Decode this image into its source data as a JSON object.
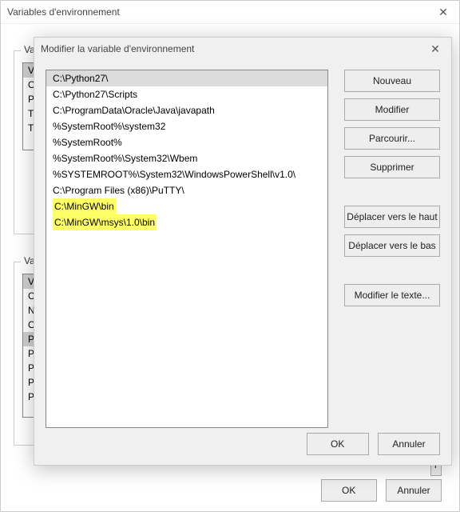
{
  "back_window": {
    "title": "Variables d'environnement",
    "close": "✕",
    "group_user_legend": "Varia",
    "group_system_legend": "Varia",
    "user_vars_col0": [
      "Va",
      "On",
      "Pa",
      "TE",
      "TM"
    ],
    "system_vars_col0": [
      "Va",
      "Co",
      "NU",
      "OS",
      "Pa",
      "PA",
      "PR",
      "PR",
      "PR"
    ],
    "footer": {
      "ok": "OK",
      "cancel": "Annuler"
    },
    "trunc_btn": "r"
  },
  "front_window": {
    "title": "Modifier la variable d'environnement",
    "close": "✕",
    "paths": [
      {
        "text": "C:\\Python27\\",
        "selected": true
      },
      {
        "text": "C:\\Python27\\Scripts"
      },
      {
        "text": "C:\\ProgramData\\Oracle\\Java\\javapath"
      },
      {
        "text": "%SystemRoot%\\system32"
      },
      {
        "text": "%SystemRoot%"
      },
      {
        "text": "%SystemRoot%\\System32\\Wbem"
      },
      {
        "text": "%SYSTEMROOT%\\System32\\WindowsPowerShell\\v1.0\\"
      },
      {
        "text": "C:\\Program Files (x86)\\PuTTY\\"
      },
      {
        "text": "C:\\MinGW\\bin",
        "highlight": true
      },
      {
        "text": "C:\\MinGW\\msys\\1.0\\bin",
        "highlight": true
      }
    ],
    "buttons": {
      "new": "Nouveau",
      "edit": "Modifier",
      "browse": "Parcourir...",
      "delete": "Supprimer",
      "move_up": "Déplacer vers le haut",
      "move_down": "Déplacer vers le bas",
      "edit_text": "Modifier le texte..."
    },
    "footer": {
      "ok": "OK",
      "cancel": "Annuler"
    }
  }
}
